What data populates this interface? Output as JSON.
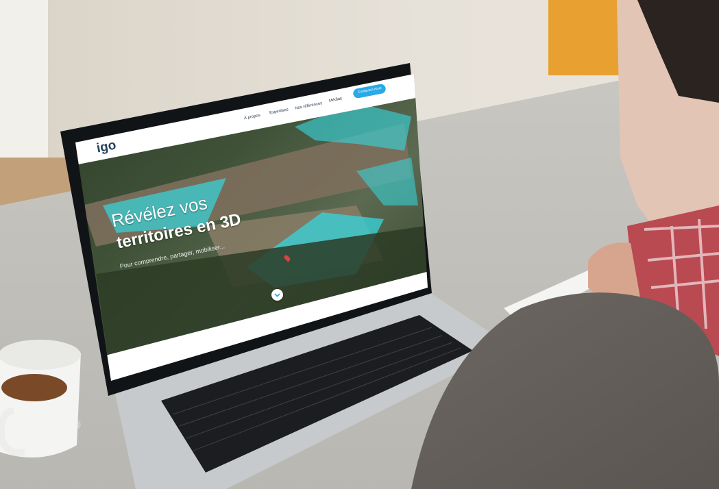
{
  "site": {
    "logo_text": "igo",
    "nav": {
      "items": [
        "À propos",
        "Expertises",
        "Nos références",
        "Médias"
      ],
      "cta_label": "Contactez-nous"
    },
    "hero": {
      "title_line1": "Révélez vos",
      "title_line2": "territoires en 3D",
      "subtitle": "Pour comprendre, partager, mobiliser..."
    }
  },
  "colors": {
    "accent_blue": "#2aa9e6",
    "map_water_overlay": "#39d0d6",
    "screen_bezel": "#111417",
    "laptop_body": "#cfd2d5"
  },
  "icons": {
    "scroll_down": "chevron-down-icon"
  }
}
